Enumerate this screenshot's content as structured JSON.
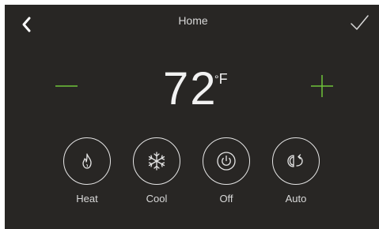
{
  "header": {
    "title": "Home"
  },
  "thermostat": {
    "temperature": "72",
    "degree_symbol": "°",
    "unit": "F"
  },
  "modes": [
    {
      "label": "Heat",
      "icon": "flame-icon"
    },
    {
      "label": "Cool",
      "icon": "snowflake-icon"
    },
    {
      "label": "Off",
      "icon": "power-icon"
    },
    {
      "label": "Auto",
      "icon": "auto-cycle-icon"
    }
  ],
  "colors": {
    "accent": "#6fc43a",
    "background": "#282624",
    "foreground": "#e8e8e8"
  }
}
